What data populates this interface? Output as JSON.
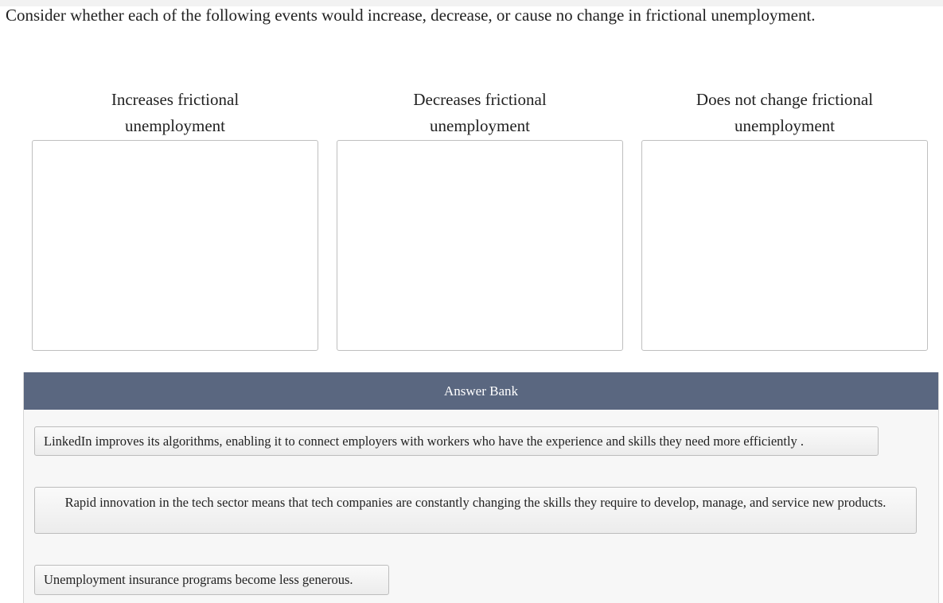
{
  "question": "Consider whether each of the following events would increase, decrease, or cause no change in frictional unemployment.",
  "categories": [
    {
      "label_line1": "Increases frictional",
      "label_line2": "unemployment"
    },
    {
      "label_line1": "Decreases frictional",
      "label_line2": "unemployment"
    },
    {
      "label_line1": "Does not change frictional",
      "label_line2": "unemployment"
    }
  ],
  "answer_bank": {
    "title": "Answer Bank",
    "items": [
      "LinkedIn improves its algorithms, enabling it to connect employers with workers who have the experience and skills they need more efficiently .",
      "Rapid innovation in the tech sector means that tech companies are constantly changing the skills they require to develop, manage, and service new products.",
      "Unemployment insurance programs become less generous."
    ]
  }
}
